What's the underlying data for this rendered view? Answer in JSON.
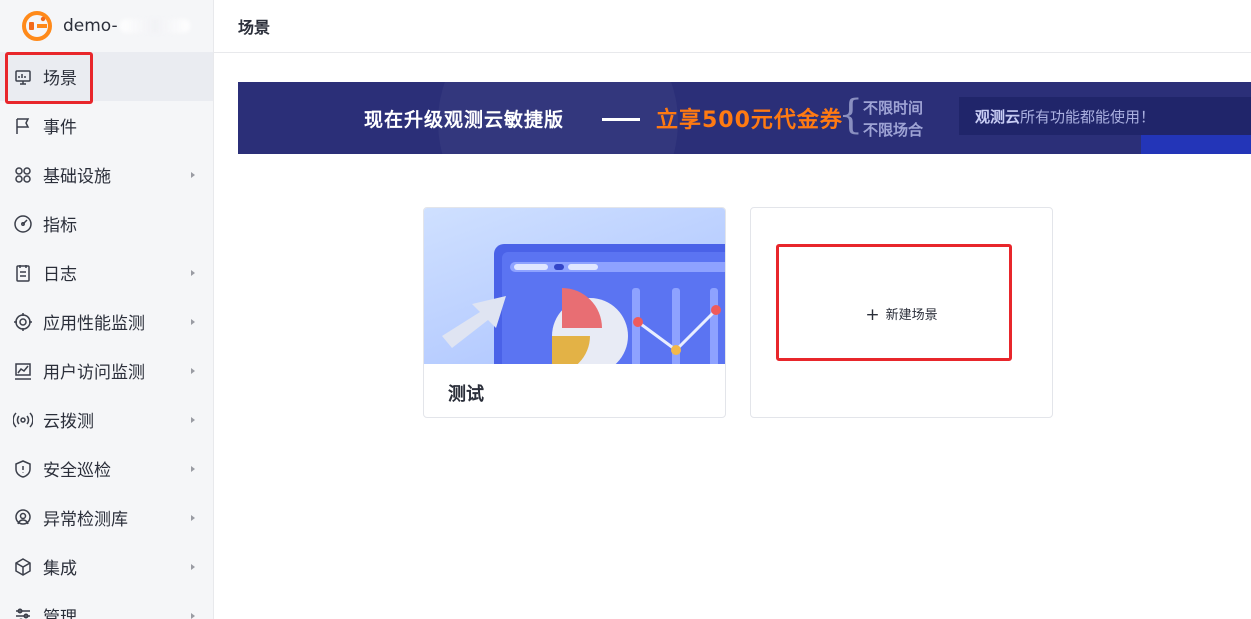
{
  "workspace": {
    "name": "demo-"
  },
  "sidebar": {
    "items": [
      {
        "label": "场景",
        "icon": "monitor-icon",
        "active": true,
        "expandable": false
      },
      {
        "label": "事件",
        "icon": "flag-icon",
        "active": false,
        "expandable": false
      },
      {
        "label": "基础设施",
        "icon": "grid-icon",
        "active": false,
        "expandable": true
      },
      {
        "label": "指标",
        "icon": "gauge-icon",
        "active": false,
        "expandable": false
      },
      {
        "label": "日志",
        "icon": "log-icon",
        "active": false,
        "expandable": true
      },
      {
        "label": "应用性能监测",
        "icon": "target-icon",
        "active": false,
        "expandable": true
      },
      {
        "label": "用户访问监测",
        "icon": "chart-icon",
        "active": false,
        "expandable": true
      },
      {
        "label": "云拨测",
        "icon": "signal-icon",
        "active": false,
        "expandable": true
      },
      {
        "label": "安全巡检",
        "icon": "shield-icon",
        "active": false,
        "expandable": true
      },
      {
        "label": "异常检测库",
        "icon": "radar-icon",
        "active": false,
        "expandable": true
      },
      {
        "label": "集成",
        "icon": "cube-icon",
        "active": false,
        "expandable": true
      },
      {
        "label": "管理",
        "icon": "sliders-icon",
        "active": false,
        "expandable": true
      }
    ]
  },
  "header": {
    "title": "场景"
  },
  "banner": {
    "headline": "现在升级观测云敏捷版",
    "offer": "立享500元代金券",
    "limit_1": "不限时间",
    "limit_2": "不限场合",
    "note_brand": "观测云",
    "note_text": "所有功能都能使用！"
  },
  "scenes": {
    "card_title": "测试",
    "new_label": "新建场景"
  },
  "colors": {
    "highlight": "#e8262b",
    "banner_bg": "#2b2f78",
    "offer": "#ff7a12",
    "logo": "#ff7a12"
  }
}
